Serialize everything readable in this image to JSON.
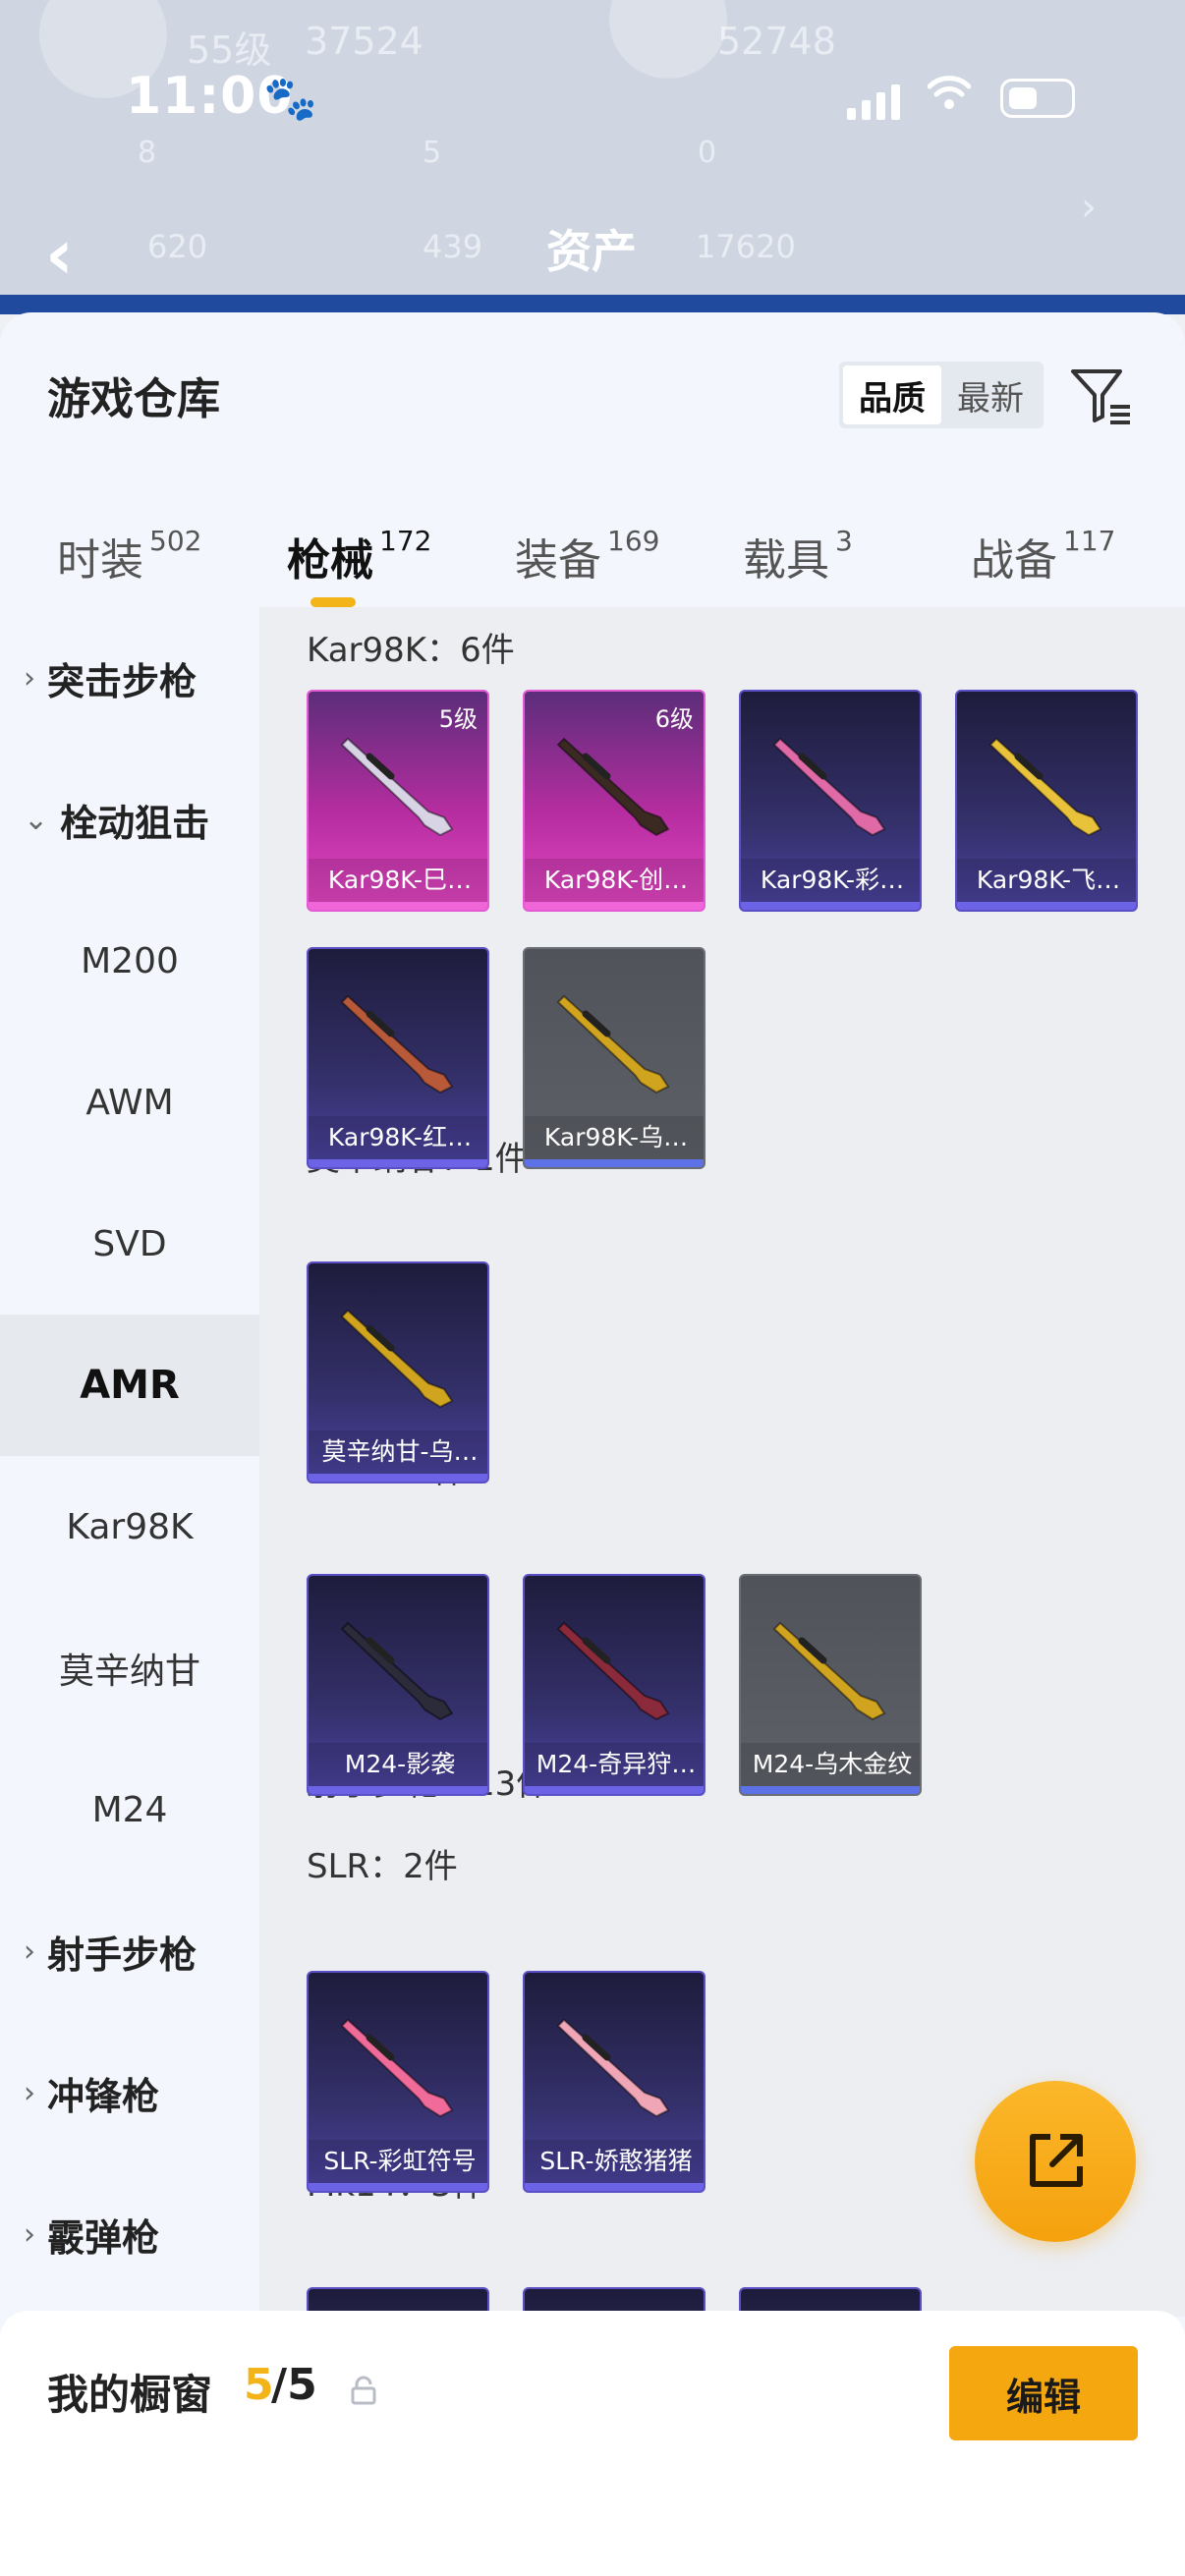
{
  "status_bar": {
    "time": "11:00"
  },
  "background_header": {
    "title": "资产",
    "faded_numbers": [
      "55级",
      "37524",
      "52748",
      "8",
      "5",
      "0",
      "620",
      "439",
      "17620"
    ]
  },
  "sheet": {
    "title": "游戏仓库",
    "sort_options": [
      "品质",
      "最新"
    ],
    "active_sort": "品质"
  },
  "tabs": [
    {
      "label": "时装",
      "count": "502"
    },
    {
      "label": "枪械",
      "count": "172",
      "active": true
    },
    {
      "label": "装备",
      "count": "169"
    },
    {
      "label": "载具",
      "count": "3"
    },
    {
      "label": "战备",
      "count": "117"
    }
  ],
  "left_nav": [
    {
      "label": "突击步枪",
      "type": "group",
      "expanded": false
    },
    {
      "label": "栓动狙击",
      "type": "group",
      "expanded": true
    },
    {
      "label": "M200",
      "type": "item"
    },
    {
      "label": "AWM",
      "type": "item"
    },
    {
      "label": "SVD",
      "type": "item"
    },
    {
      "label": "AMR",
      "type": "item",
      "selected": true
    },
    {
      "label": "Kar98K",
      "type": "item"
    },
    {
      "label": "莫辛纳甘",
      "type": "item"
    },
    {
      "label": "M24",
      "type": "item"
    },
    {
      "label": "射手步枪",
      "type": "group",
      "expanded": false
    },
    {
      "label": "冲锋枪",
      "type": "group",
      "expanded": false
    },
    {
      "label": "霰弹枪",
      "type": "group",
      "expanded": false
    }
  ],
  "sections": [
    {
      "title": "Kar98K：6件",
      "items": [
        {
          "name": "Kar98K-巳…",
          "level": "5级",
          "rarity": "pink",
          "color": "#d8d4e6"
        },
        {
          "name": "Kar98K-创…",
          "level": "6级",
          "rarity": "pink",
          "color": "#3a2a22"
        },
        {
          "name": "Kar98K-彩…",
          "rarity": "purple",
          "color": "#e06aa8"
        },
        {
          "name": "Kar98K-飞…",
          "rarity": "purple",
          "color": "#e8c23a"
        },
        {
          "name": "Kar98K-红…",
          "rarity": "purple",
          "color": "#b85a3a"
        },
        {
          "name": "Kar98K-乌…",
          "rarity": "grey",
          "color": "#d0a41e"
        }
      ]
    },
    {
      "title": "莫辛纳甘：1件",
      "items": [
        {
          "name": "莫辛纳甘-乌…",
          "rarity": "purple",
          "color": "#d0a41e"
        }
      ]
    },
    {
      "title": "M24：3件",
      "items": [
        {
          "name": "M24-影袭",
          "rarity": "purple",
          "color": "#2b2b3a"
        },
        {
          "name": "M24-奇异狩…",
          "rarity": "purple",
          "color": "#8a2a3a"
        },
        {
          "name": "M24-乌木金纹",
          "rarity": "grey",
          "color": "#d0a41e"
        }
      ]
    },
    {
      "title": "射手步枪：13件",
      "items": []
    },
    {
      "title": "SLR：2件",
      "items": [
        {
          "name": "SLR-彩虹符号",
          "rarity": "purple",
          "color": "#f06a9a"
        },
        {
          "name": "SLR-娇憨猪猪",
          "rarity": "purple",
          "color": "#f0a6b6"
        }
      ]
    },
    {
      "title": "Mk14：3件",
      "items": [
        {
          "name": "",
          "rarity": "purple",
          "color": "#3a3a5a"
        },
        {
          "name": "",
          "rarity": "purple",
          "color": "#3a3a5a"
        },
        {
          "name": "",
          "rarity": "purple",
          "color": "#3a3a5a"
        }
      ]
    }
  ],
  "bottom_bar": {
    "label": "我的橱窗",
    "count": "5",
    "total": "/5",
    "edit_label": "编辑"
  },
  "colors": {
    "accent": "#f5a710",
    "tab_underline": "#f2b418",
    "pink_card": "#b52da0",
    "purple_card": "#34306a",
    "grey_card": "#5e6168"
  }
}
